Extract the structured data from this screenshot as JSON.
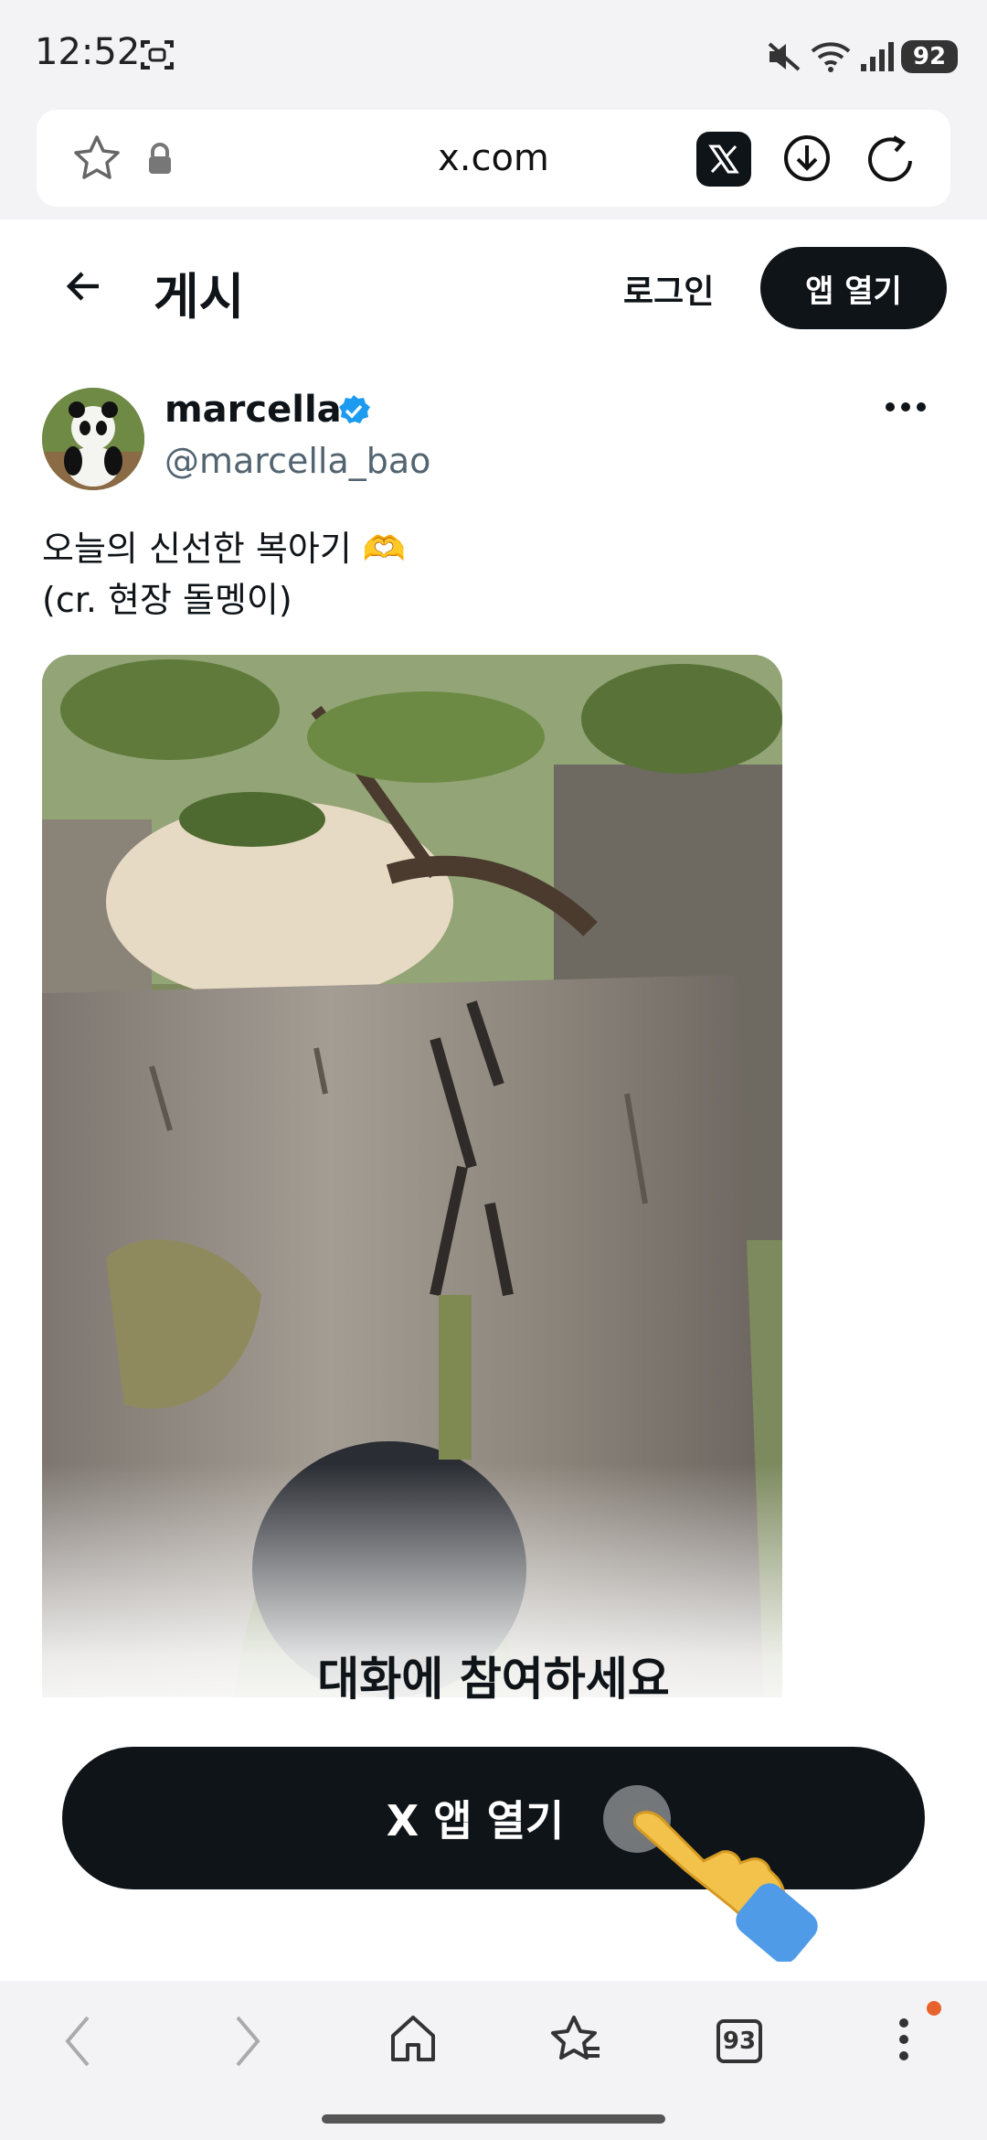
{
  "status_bar": {
    "time": "12:52",
    "battery": "92"
  },
  "browser": {
    "url": "x.com"
  },
  "header": {
    "title": "게시",
    "login_label": "로그인",
    "open_app_label": "앱 열기"
  },
  "post": {
    "author_name": "marcella",
    "author_handle": "@marcella_bao",
    "text": "오늘의 신선한 복아기 🫶\n(cr. 현장 돌멩이)"
  },
  "overlay": {
    "join_text": "대화에 참여하세요",
    "cta_label": "X 앱 열기"
  },
  "bottom_nav": {
    "tabs_count": "93"
  },
  "colors": {
    "accent_dark": "#0f1419",
    "verified": "#1d9bf0",
    "handle": "#536471",
    "notif": "#e8632b"
  },
  "icons": [
    "screenshot-icon",
    "mute-icon",
    "wifi-icon",
    "signal-icon",
    "star-icon",
    "lock-icon",
    "x-logo-icon",
    "download-icon",
    "reload-icon",
    "back-arrow-icon",
    "verified-badge-icon",
    "more-icon",
    "hand-pointer-icon",
    "nav-back-icon",
    "nav-forward-icon",
    "home-icon",
    "bookmarks-icon",
    "tabs-icon",
    "menu-icon"
  ]
}
